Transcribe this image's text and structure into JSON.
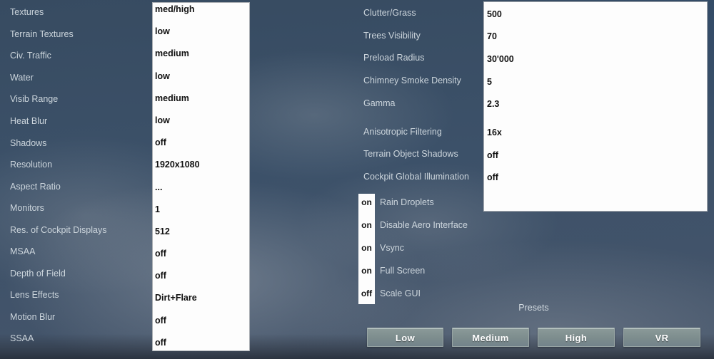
{
  "colors": {
    "sky": "#3c5169",
    "cloud": "#8d98a3",
    "label_text": "#ccd5dc",
    "value_text": "#111111",
    "box_bg": "#fdfdfd",
    "button_bg": "#7c8c8d",
    "button_text": "#ffffff"
  },
  "left_panel": {
    "rows": [
      {
        "label": "Textures",
        "value": "med/high"
      },
      {
        "label": "Terrain Textures",
        "value": "low"
      },
      {
        "label": "Civ. Traffic",
        "value": "medium"
      },
      {
        "label": "Water",
        "value": "low"
      },
      {
        "label": "Visib Range",
        "value": "medium"
      },
      {
        "label": "Heat Blur",
        "value": "low"
      },
      {
        "label": "Shadows",
        "value": "off"
      },
      {
        "label": "Resolution",
        "value": "1920x1080"
      },
      {
        "label": "Aspect Ratio",
        "value": "..."
      },
      {
        "label": "Monitors",
        "value": "1"
      },
      {
        "label": "Res. of Cockpit Displays",
        "value": "512"
      },
      {
        "label": "MSAA",
        "value": "off"
      },
      {
        "label": "Depth of Field",
        "value": "off"
      },
      {
        "label": "Lens Effects",
        "value": "Dirt+Flare"
      },
      {
        "label": "Motion Blur",
        "value": "off"
      },
      {
        "label": "SSAA",
        "value": "off"
      }
    ]
  },
  "right_panel": {
    "group1": [
      {
        "label": "Clutter/Grass",
        "value": "500"
      },
      {
        "label": "Trees Visibility",
        "value": "70"
      },
      {
        "label": "Preload Radius",
        "value": "30'000"
      },
      {
        "label": "Chimney Smoke Density",
        "value": "5"
      },
      {
        "label": "Gamma",
        "value": "2.3"
      }
    ],
    "group2": [
      {
        "label": "Anisotropic Filtering",
        "value": "16x"
      },
      {
        "label": "Terrain Object Shadows",
        "value": "off"
      },
      {
        "label": "Cockpit Global Illumination",
        "value": "off"
      }
    ],
    "toggles": [
      {
        "state": "on",
        "label": "Rain Droplets"
      },
      {
        "state": "on",
        "label": "Disable Aero Interface"
      },
      {
        "state": "on",
        "label": "Vsync"
      },
      {
        "state": "on",
        "label": "Full Screen"
      },
      {
        "state": "off",
        "label": "Scale GUI"
      }
    ]
  },
  "presets": {
    "title": "Presets",
    "buttons": [
      {
        "label": "Low"
      },
      {
        "label": "Medium"
      },
      {
        "label": "High"
      },
      {
        "label": "VR"
      }
    ]
  }
}
